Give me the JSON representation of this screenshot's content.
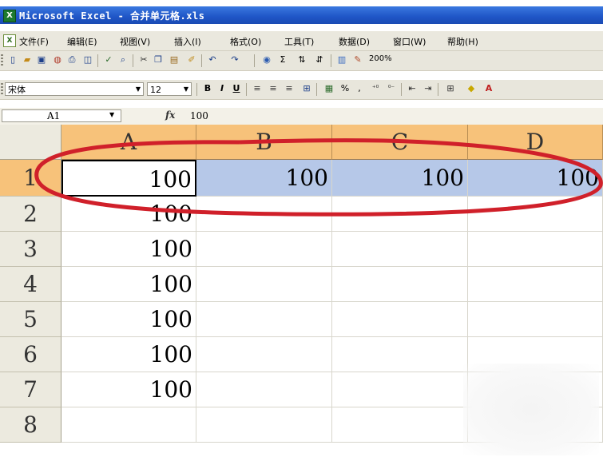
{
  "window": {
    "app_icon": "excel-icon",
    "title": "Microsoft Excel - 合并单元格.xls"
  },
  "menubar": {
    "items": [
      "文件(F)",
      "编辑(E)",
      "视图(V)",
      "插入(I)",
      "格式(O)",
      "工具(T)",
      "数据(D)",
      "窗口(W)",
      "帮助(H)"
    ]
  },
  "standard_toolbar": {
    "zoom": "200%",
    "icons": [
      "new-icon",
      "open-icon",
      "save-icon",
      "permission-icon",
      "print-icon",
      "print-preview-icon",
      "spelling-icon",
      "research-icon",
      "cut-icon",
      "copy-icon",
      "paste-icon",
      "format-painter-icon",
      "undo-icon",
      "redo-icon",
      "hyperlink-icon",
      "autosum-icon",
      "sort-ascending-icon",
      "sort-descending-icon",
      "chart-wizard-icon",
      "drawing-icon"
    ]
  },
  "formatting_toolbar": {
    "font_name": "宋体",
    "font_size": "12",
    "bold": "B",
    "italic": "I",
    "underline": "U",
    "percent": "%",
    "comma": ","
  },
  "formula_bar": {
    "name_box": "A1",
    "fx_label": "fx",
    "value": "100"
  },
  "sheet": {
    "columns": [
      "A",
      "B",
      "C",
      "D"
    ],
    "rows": [
      "1",
      "2",
      "3",
      "4",
      "5",
      "6",
      "7",
      "8"
    ],
    "cells": [
      [
        "100",
        "100",
        "100",
        "100"
      ],
      [
        "100",
        "",
        "",
        ""
      ],
      [
        "100",
        "",
        "",
        ""
      ],
      [
        "100",
        "",
        "",
        ""
      ],
      [
        "100",
        "",
        "",
        ""
      ],
      [
        "100",
        "",
        "",
        ""
      ],
      [
        "100",
        "",
        "",
        ""
      ],
      [
        "",
        "",
        "",
        ""
      ]
    ],
    "active_cell": "A1",
    "selected_range": "A1:D1"
  },
  "colors": {
    "title_bar": "#1f55c6",
    "header_highlight": "#f7c27a",
    "selection_fill": "#b6c8e8",
    "annotation_circle": "#d0202a"
  }
}
